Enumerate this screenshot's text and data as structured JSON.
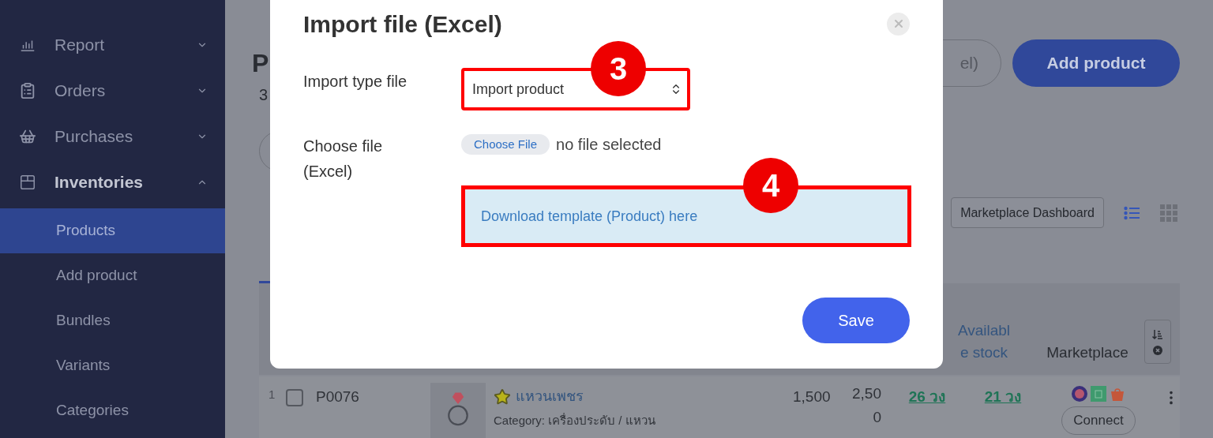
{
  "sidebar": {
    "items": [
      {
        "label": "Report",
        "expanded": false
      },
      {
        "label": "Orders",
        "expanded": false
      },
      {
        "label": "Purchases",
        "expanded": false
      },
      {
        "label": "Inventories",
        "expanded": true,
        "children": [
          {
            "label": "Products",
            "selected": true
          },
          {
            "label": "Add product",
            "selected": false
          },
          {
            "label": "Bundles",
            "selected": false
          },
          {
            "label": "Variants",
            "selected": false
          },
          {
            "label": "Categories",
            "selected": false
          }
        ]
      }
    ]
  },
  "page": {
    "title": "P",
    "subtitle": "3",
    "buttons": [
      {
        "label": "el)",
        "kind": "outline"
      },
      {
        "label": "Add product",
        "kind": "primary"
      }
    ],
    "dashboard_button": "Marketplace Dashboard",
    "view_modes": [
      {
        "kind": "list",
        "selected": true
      },
      {
        "kind": "grid",
        "selected": false
      }
    ]
  },
  "table": {
    "columns": [
      "Available stock",
      "Marketplace"
    ],
    "rows": [
      {
        "index": "1",
        "checked": false,
        "code": "P0076",
        "starred": true,
        "name": "แหวนเพชร",
        "category": "Category: เครื่องประดับ / แหวน",
        "price": "1,500",
        "column_6": "2,500",
        "stock": "26 วง",
        "available": "21 วง",
        "action": "Connect"
      }
    ]
  },
  "modal": {
    "title": "Import file (Excel)",
    "fields": [
      {
        "label": "Import type file",
        "kind": "select",
        "value": "Import product",
        "marker": "3"
      },
      {
        "label": "Choose file (Excel)",
        "kind": "file",
        "button": "Choose File",
        "value": "no file selected"
      }
    ],
    "template_link": {
      "text": "Download template (Product) here",
      "marker": "4"
    },
    "save": "Save"
  }
}
